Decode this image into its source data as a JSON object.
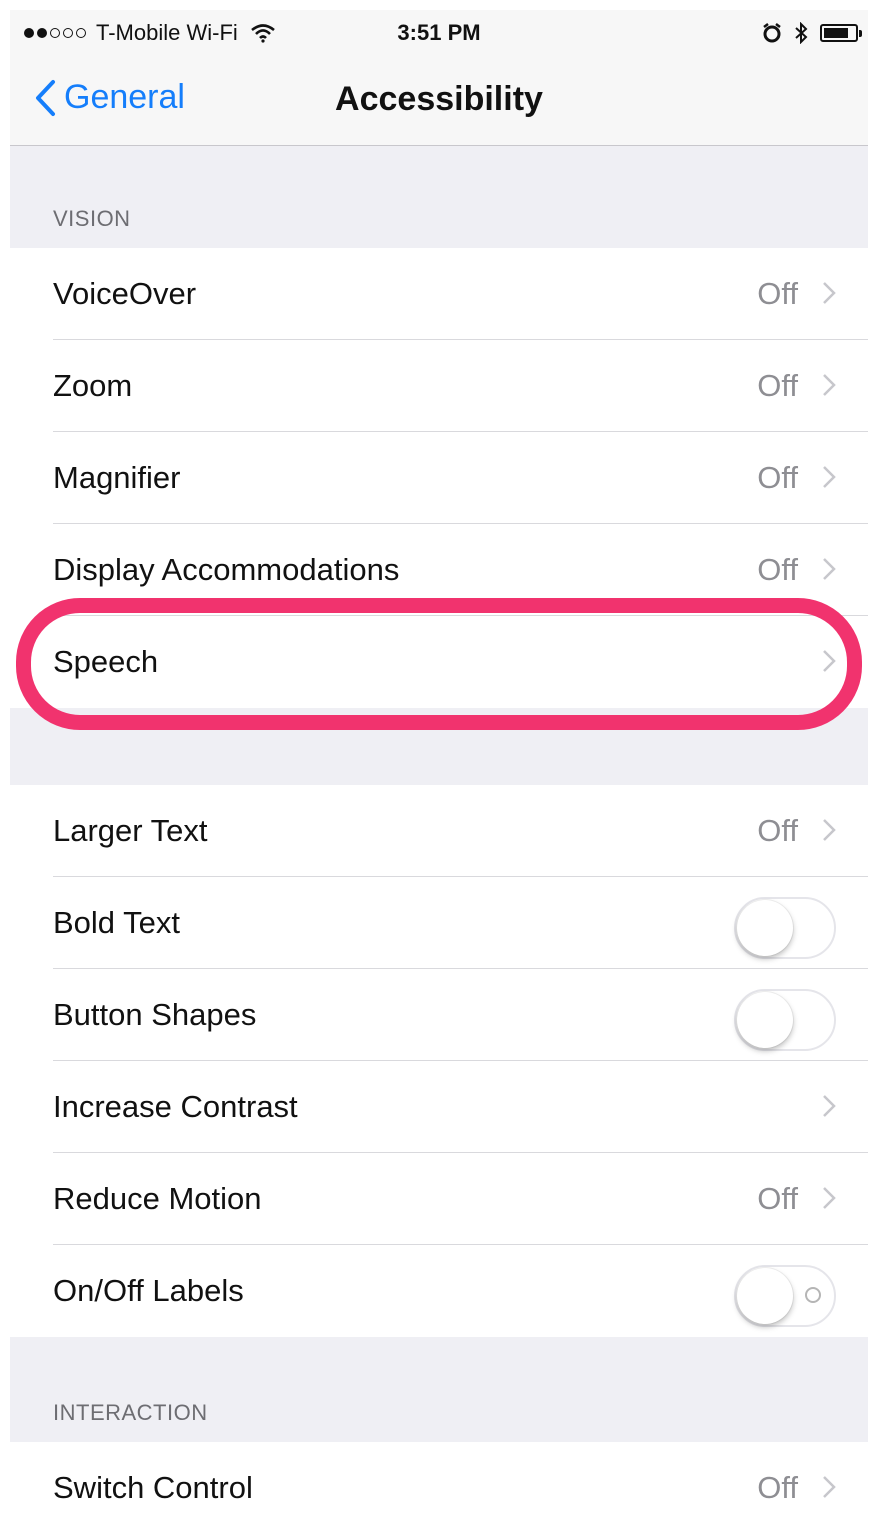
{
  "status_bar": {
    "carrier": "T-Mobile Wi-Fi",
    "time": "3:51 PM",
    "signal_dots_filled": 2,
    "signal_dots_total": 5,
    "battery_level": 0.72
  },
  "nav": {
    "back_label": "General",
    "title": "Accessibility"
  },
  "sections": {
    "vision_header": "VISION",
    "interaction_header": "INTERACTION"
  },
  "vision_rows": [
    {
      "label": "VoiceOver",
      "value": "Off"
    },
    {
      "label": "Zoom",
      "value": "Off"
    },
    {
      "label": "Magnifier",
      "value": "Off"
    },
    {
      "label": "Display Accommodations",
      "value": "Off"
    },
    {
      "label": "Speech",
      "value": ""
    }
  ],
  "text_rows": [
    {
      "label": "Larger Text",
      "value": "Off"
    },
    {
      "label": "Bold Text",
      "toggle": "off"
    },
    {
      "label": "Button Shapes",
      "toggle": "off"
    },
    {
      "label": "Increase Contrast",
      "value": ""
    },
    {
      "label": "Reduce Motion",
      "value": "Off"
    },
    {
      "label": "On/Off Labels",
      "toggle": "off"
    }
  ],
  "interaction_rows": [
    {
      "label": "Switch Control",
      "value": "Off"
    }
  ],
  "colors": {
    "accent": "#157efb",
    "highlight": "#f1336e",
    "background": "#efeff4"
  }
}
